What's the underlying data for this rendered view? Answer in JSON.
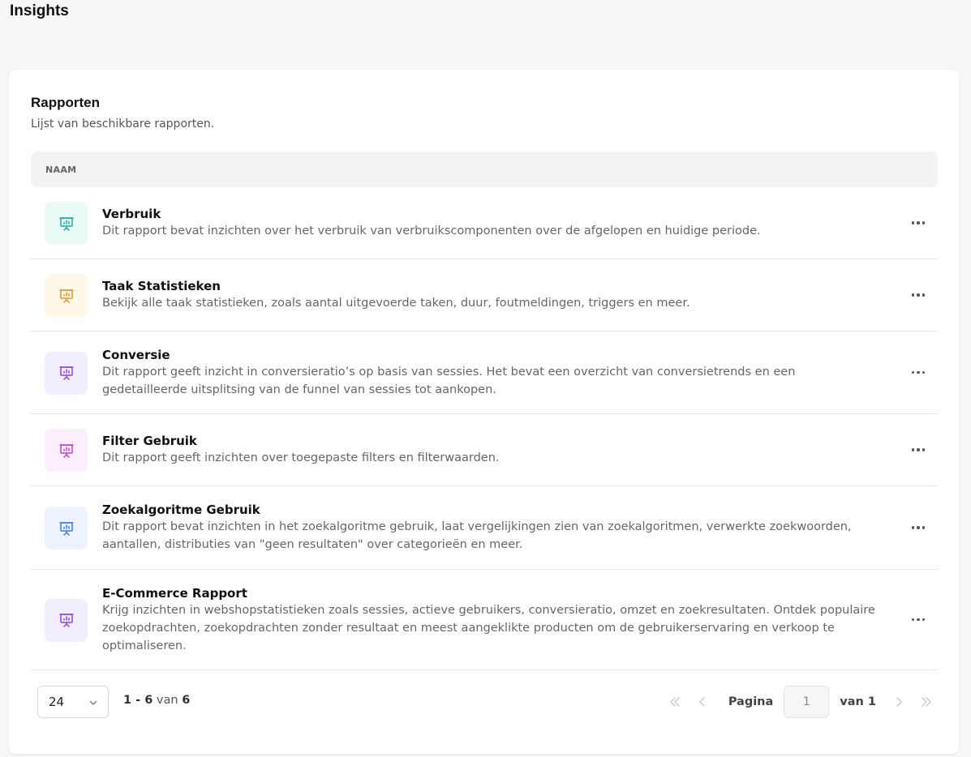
{
  "page": {
    "title": "Insights"
  },
  "card": {
    "title": "Rapporten",
    "subtitle": "Lijst van beschikbare rapporten."
  },
  "table": {
    "header": "NAAM",
    "rows": [
      {
        "name": "Verbruik",
        "description": "Dit rapport bevat inzichten over het verbruik van verbruikscomponenten over de afgelopen en huidige periode.",
        "icon": "presentation-chart-icon",
        "icon_color": "#1fa99a",
        "icon_bg": "#eafaf7"
      },
      {
        "name": "Taak Statistieken",
        "description": "Bekijk alle taak statistieken, zoals aantal uitgevoerde taken, duur, foutmeldingen, triggers en meer.",
        "icon": "presentation-chart-icon",
        "icon_color": "#e0952a",
        "icon_bg": "#fff7e8"
      },
      {
        "name": "Conversie",
        "description": "Dit rapport geeft inzicht in conversieratio’s op basis van sessies. Het bevat een overzicht van conversietrends en een gedetailleerde uitsplitsing van de funnel van sessies tot aankopen.",
        "icon": "presentation-chart-icon",
        "icon_color": "#8a45e6",
        "icon_bg": "#f3eefd"
      },
      {
        "name": "Filter Gebruik",
        "description": "Dit rapport geeft inzichten over toegepaste filters en filterwaarden.",
        "icon": "presentation-chart-icon",
        "icon_color": "#c43fd6",
        "icon_bg": "#fbeefd"
      },
      {
        "name": "Zoekalgoritme Gebruik",
        "description": "Dit rapport bevat inzichten in het zoekalgoritme gebruik, laat vergelijkingen zien van zoekalgoritmen, verwerkte zoekwoorden, aantallen, distributies van \"geen resultaten\" over categorieën en meer.",
        "icon": "presentation-chart-icon",
        "icon_color": "#3b7be8",
        "icon_bg": "#ecf3fe"
      },
      {
        "name": "E-Commerce Rapport",
        "description": "Krijg inzichten in webshopstatistieken zoals sessies, actieve gebruikers, conversieratio, omzet en zoekresultaten. Ontdek populaire zoekopdrachten, zoekopdrachten zonder resultaat en meest aangeklikte producten om de gebruikerservaring en verkoop te optimaliseren.",
        "icon": "presentation-chart-icon",
        "icon_color": "#8a45e6",
        "icon_bg": "#f3eefd"
      }
    ]
  },
  "footer": {
    "page_size": "24",
    "range_start": "1",
    "range_end": "6",
    "range_of": "van",
    "range_total": "6",
    "page_label": "Pagina",
    "page_value": "1",
    "page_of": "van 1"
  }
}
